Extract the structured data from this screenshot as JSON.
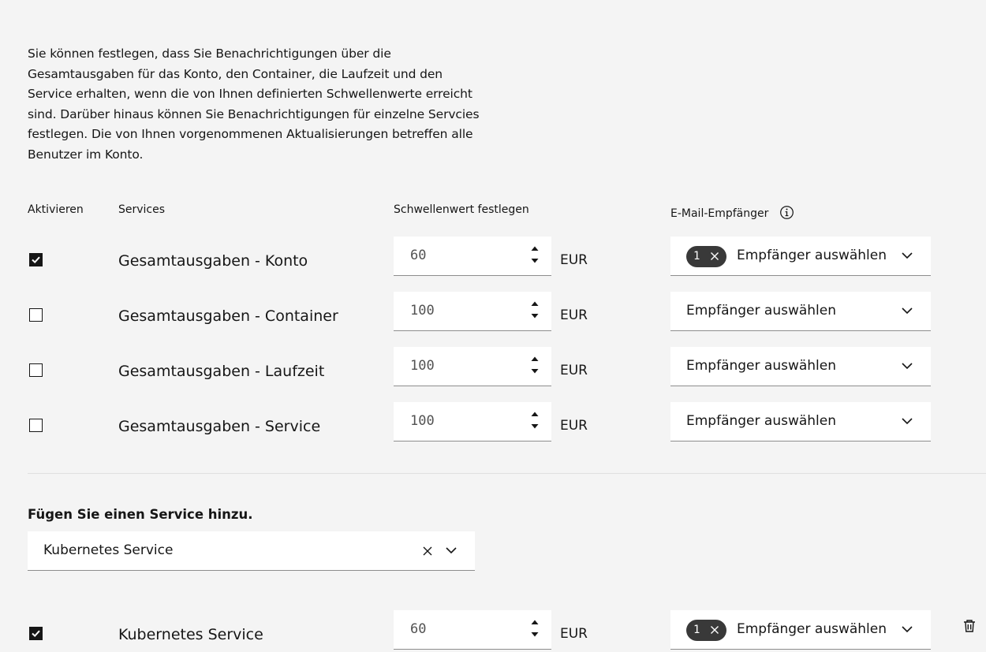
{
  "intro_text": "Sie können festlegen, dass Sie Benachrichtigungen über die Gesamtausgaben für das Konto, den Container, die Laufzeit und den Service erhalten, wenn die von Ihnen definierten Schwellenwerte erreicht sind. Darüber hinaus können Sie Benachrichtigungen für einzelne Servcies festlegen. Die von Ihnen vorgenommenen Aktualisierungen betreffen alle Benutzer im Konto.",
  "headers": {
    "enable": "Aktivieren",
    "services": "Services",
    "threshold": "Schwellenwert festlegen",
    "recipients": "E-Mail-Empfänger"
  },
  "rows": [
    {
      "checked": true,
      "service": "Gesamtausgaben - Konto",
      "threshold": "60",
      "unit": "EUR",
      "tag_count": "1",
      "placeholder": "Empfänger auswählen"
    },
    {
      "checked": false,
      "service": "Gesamtausgaben - Container",
      "threshold": "100",
      "unit": "EUR",
      "tag_count": "",
      "placeholder": "Empfänger auswählen"
    },
    {
      "checked": false,
      "service": "Gesamtausgaben - Laufzeit",
      "threshold": "100",
      "unit": "EUR",
      "tag_count": "",
      "placeholder": "Empfänger auswählen"
    },
    {
      "checked": false,
      "service": "Gesamtausgaben - Service",
      "threshold": "100",
      "unit": "EUR",
      "tag_count": "",
      "placeholder": "Empfänger auswählen"
    }
  ],
  "add_service": {
    "title": "Fügen Sie einen Service hinzu.",
    "selected": "Kubernetes Service"
  },
  "service_row": {
    "checked": true,
    "service": "Kubernetes Service",
    "threshold": "60",
    "unit": "EUR",
    "tag_count": "1",
    "placeholder": "Empfänger auswählen"
  },
  "icons": {
    "info": "information-icon",
    "checkmark": "checkmark-icon",
    "spinner": "caret-up-down-icon",
    "close": "close-icon",
    "chevron": "chevron-down-icon",
    "trash": "trash-can-icon"
  },
  "colors": {
    "background": "#f4f4f4",
    "field": "#ffffff",
    "text": "#161616",
    "tag": "#393939",
    "border": "#8d8d8d"
  }
}
